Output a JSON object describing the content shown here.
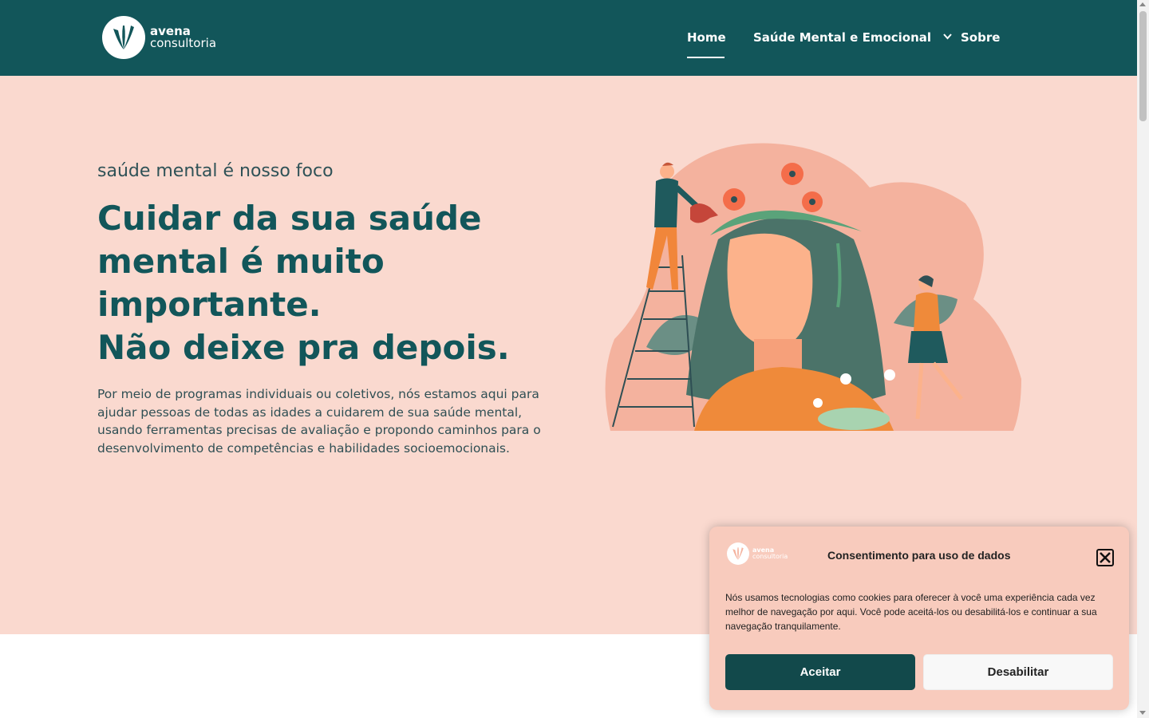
{
  "brand": {
    "name_line1": "avena",
    "name_line2": "consultoria"
  },
  "nav": {
    "items": [
      {
        "label": "Home",
        "active": true
      },
      {
        "label": "Saúde Mental e Emocional",
        "has_dropdown": true
      },
      {
        "label": "Sobre"
      }
    ]
  },
  "hero": {
    "kicker": "saúde mental é nosso foco",
    "headline_lines": [
      "Cuidar da sua saúde",
      "mental é muito",
      "importante.",
      "Não deixe pra depois."
    ],
    "description": "Por meio de programas individuais ou coletivos, nós estamos aqui para ajudar pessoas de todas as idades a cuidarem de sua saúde mental, usando ferramentas precisas de avaliação e propondo caminhos para o desenvolvimento de competências e habilidades socioemocionais."
  },
  "cookie": {
    "title": "Consentimento para uso de dados",
    "text": "Nós usamos tecnologias como cookies para oferecer à você uma experiência cada vez melhor de navegação por aqui. Você pode aceitá-los ou desabilitá-los e continuar a sua navegação tranquilamente.",
    "accept_label": "Aceitar",
    "deny_label": "Desabilitar"
  },
  "colors": {
    "header_bg": "#12565a",
    "hero_bg": "#fad9cf",
    "headline": "#12565a",
    "cookie_bg": "#f8cbbd",
    "accept_bg": "#12494b"
  }
}
